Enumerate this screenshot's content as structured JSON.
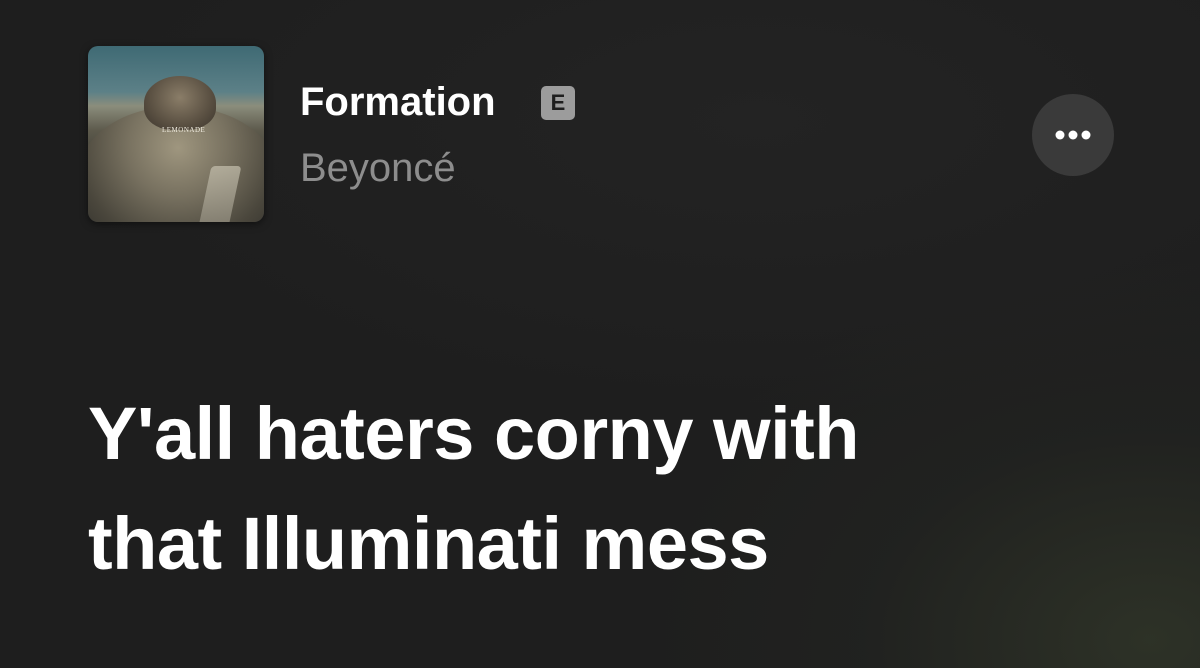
{
  "song": {
    "title": "Formation",
    "explicit_badge": "E",
    "artist": "Beyoncé",
    "artwork_label": "LEMONADE"
  },
  "controls": {
    "more_icon": "ellipsis-icon"
  },
  "lyrics": {
    "lines": [
      "Y'all haters corny with",
      "that Illuminati mess"
    ]
  },
  "colors": {
    "background": "#1e1e1e",
    "title": "#ffffff",
    "artist": "#8d8d8d",
    "badge": "#9c9c9c",
    "more_button": "#3a3a3a"
  }
}
